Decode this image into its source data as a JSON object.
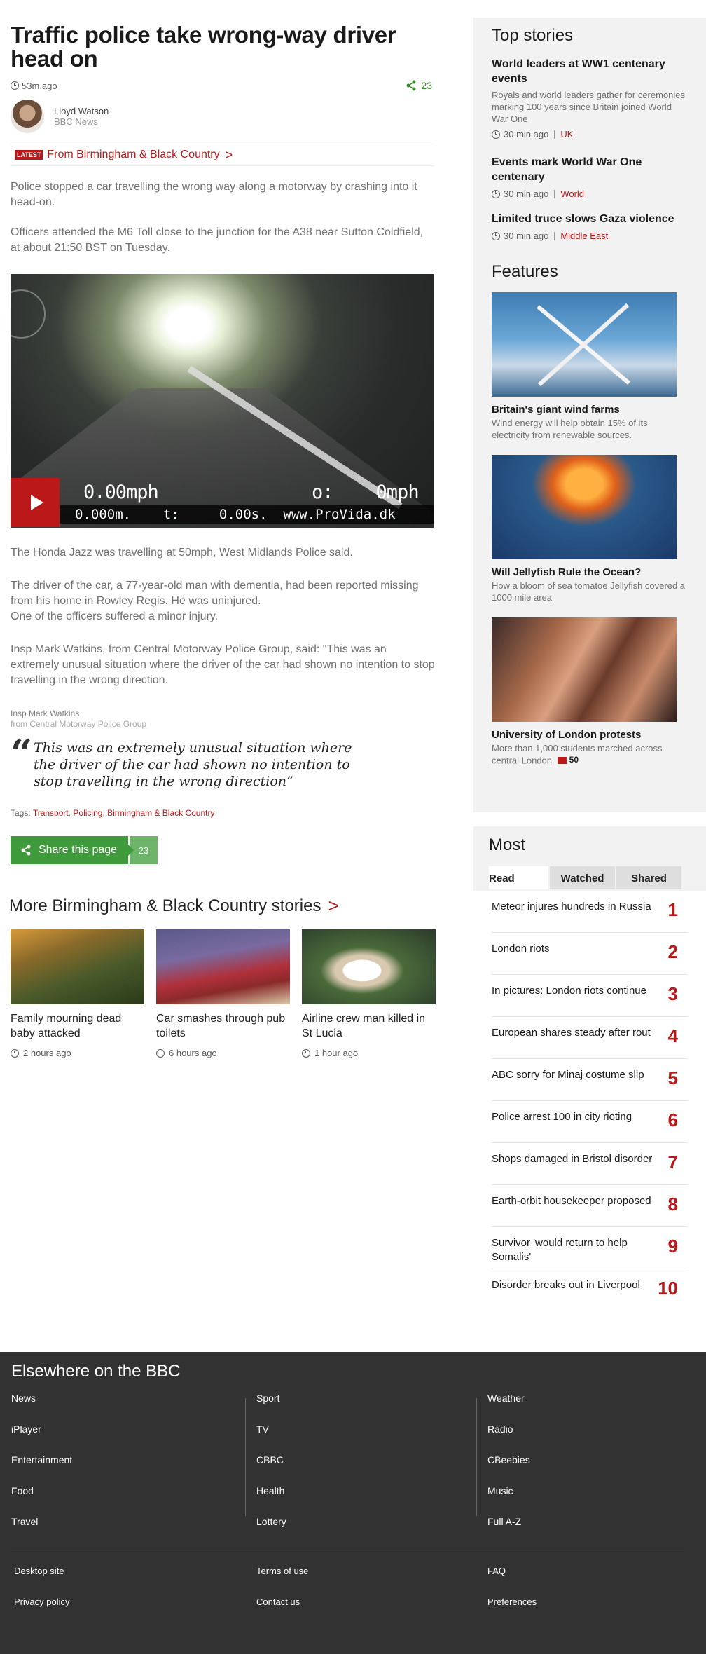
{
  "article": {
    "headline": "Traffic police take wrong-way driver head on",
    "time": "53m ago",
    "share_count": "23",
    "author_name": "Lloyd Watson",
    "author_org": "BBC News",
    "latest_badge": "LATEST",
    "latest_link": "From Birmingham & Black Country",
    "intro1": "Police stopped a car travelling the wrong way along a motorway by crashing into it head-on.",
    "intro2": "Officers attended the M6 Toll close to the junction for the A38 near Sutton Coldfield, at about 21:50 BST on Tuesday.",
    "video": {
      "hud_speed": "0.00mph",
      "hud_o": "o:",
      "hud_mph": "0mph",
      "hud_line": "0.000m.    t:     0.00s.  www.ProVida.dk"
    },
    "body1": "The Honda Jazz was travelling at 50mph, West Midlands Police said.",
    "body2a": "The driver of the car, a 77-year-old man with dementia, had been reported missing from his home in Rowley Regis. He was uninjured.",
    "body2b": "One of the officers suffered a minor injury.",
    "body3": "Insp Mark Watkins, from Central Motorway Police Group, said: \"This was an extremely unusual situation where the driver of the car had shown no intention to stop travelling in the wrong direction.",
    "quote_name": "Insp Mark Watkins",
    "quote_org": "from Central Motorway Police Group",
    "quote_mark": "“",
    "quote_text": "This was an extremely unusual situation where the driver of the car had shown no intention to stop travelling in the wrong direction”",
    "tags_label": "Tags:",
    "tags": [
      "Transport",
      "Policing",
      "Birmingham & Black Country"
    ],
    "share_label": "Share this page",
    "share_num": "23"
  },
  "more": {
    "title": "More Birmingham & Black Country stories",
    "stories": [
      {
        "title": "Family mourning dead baby attacked",
        "time": "2 hours ago"
      },
      {
        "title": "Car smashes through pub toilets",
        "time": "6 hours ago"
      },
      {
        "title": "Airline crew man killed in St Lucia",
        "time": "1 hour ago"
      }
    ]
  },
  "top_stories": {
    "heading": "Top stories",
    "items": [
      {
        "title": "World leaders at WW1 centenary events",
        "summary": "Royals and world leaders gather for ceremonies marking 100 years since Britain joined World War One",
        "time": "30 min ago",
        "section": "UK"
      },
      {
        "title": "Events mark World War One centenary",
        "summary": "",
        "time": "30 min ago",
        "section": "World"
      },
      {
        "title": "Limited truce slows Gaza violence",
        "summary": "",
        "time": "30 min ago",
        "section": "Middle East"
      }
    ]
  },
  "features": {
    "heading": "Features",
    "items": [
      {
        "title": "Britain's giant wind farms",
        "summary": "Wind energy will help obtain 15% of its electricity from renewable sources.",
        "comments": ""
      },
      {
        "title": "Will Jellyfish Rule the Ocean?",
        "summary": "How a bloom of sea tomatoe Jellyfish covered a 1000 mile area",
        "comments": ""
      },
      {
        "title": "University of London protests",
        "summary": "More than 1,000 students marched across central London",
        "comments": "50"
      }
    ]
  },
  "most": {
    "heading": "Most",
    "tabs": [
      "Read",
      "Watched",
      "Shared"
    ],
    "items": [
      {
        "title": "Meteor injures hundreds in Russia",
        "num": "1"
      },
      {
        "title": "London riots",
        "num": "2"
      },
      {
        "title": "In pictures: London riots continue",
        "num": "3"
      },
      {
        "title": "European shares steady after rout",
        "num": "4"
      },
      {
        "title": "ABC sorry for Minaj costume slip",
        "num": "5"
      },
      {
        "title": "Police arrest 100 in city rioting",
        "num": "6"
      },
      {
        "title": "Shops damaged in Bristol disorder",
        "num": "7"
      },
      {
        "title": "Earth-orbit housekeeper proposed",
        "num": "8"
      },
      {
        "title": "Survivor 'would return to help Somalis'",
        "num": "9"
      },
      {
        "title": "Disorder breaks out in Liverpool",
        "num": "10"
      }
    ]
  },
  "footer": {
    "heading": "Elsewhere on the BBC",
    "col1": [
      "News",
      "iPlayer",
      "Entertainment",
      "Food",
      "Travel"
    ],
    "col2": [
      "Sport",
      "TV",
      "CBBC",
      "Health",
      "Lottery"
    ],
    "col3": [
      "Weather",
      "Radio",
      "CBeebies",
      "Music",
      "Full A-Z"
    ],
    "bottom1": [
      "Desktop site",
      "Privacy policy"
    ],
    "bottom2": [
      "Terms of use",
      "Contact us"
    ],
    "bottom3": [
      "FAQ",
      "Preferences"
    ]
  },
  "colors": {
    "accent": "#bb1919",
    "share": "#3e9a3a",
    "footer_bg": "#323232"
  }
}
